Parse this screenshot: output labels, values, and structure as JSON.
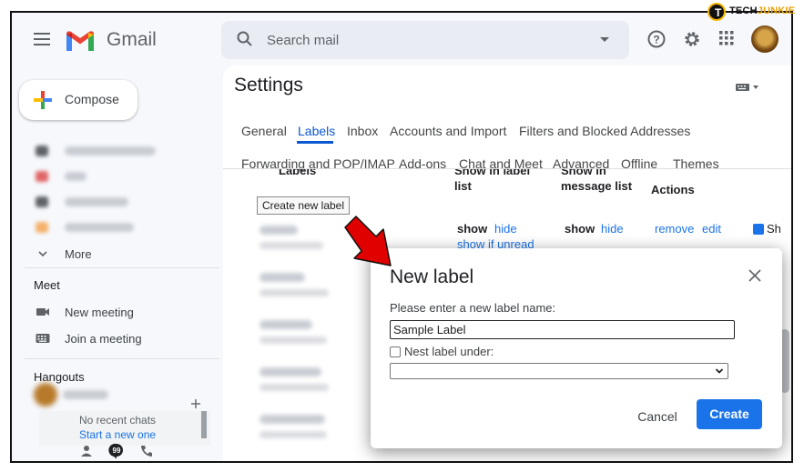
{
  "brand": {
    "app_name": "Gmail",
    "watermark_prefix": "TECH",
    "watermark_suffix": "JUNKIE"
  },
  "search": {
    "placeholder": "Search mail"
  },
  "sidebar": {
    "compose_label": "Compose",
    "more_label": "More",
    "meet_heading": "Meet",
    "meet_items": [
      {
        "label": "New meeting",
        "icon": "video-icon"
      },
      {
        "label": "Join a meeting",
        "icon": "keyboard-icon"
      }
    ],
    "hangouts_heading": "Hangouts",
    "no_chats": "No recent chats",
    "start_new": "Start a new one"
  },
  "settings": {
    "title": "Settings",
    "tabs_row1": [
      "General",
      "Labels",
      "Inbox",
      "Accounts and Import",
      "Filters and Blocked Addresses"
    ],
    "tabs_row2": [
      "Forwarding and POP/IMAP",
      "Add-ons",
      "Chat and Meet",
      "Advanced",
      "Offline",
      "Themes"
    ],
    "active_tab": "Labels",
    "columns": {
      "labels": "Labels",
      "show_in_label_list": "Show in label list",
      "show_in_message_list": "Show in message list",
      "actions": "Actions"
    },
    "create_new_label_button": "Create new label",
    "first_row": {
      "label_list_show": "show",
      "label_list_hide": "hide",
      "label_list_unread": "show if unread",
      "message_list_show": "show",
      "message_list_hide": "hide",
      "remove": "remove",
      "edit": "edit",
      "show_in_imap": "Sh"
    }
  },
  "dialog": {
    "title": "New label",
    "prompt": "Please enter a new label name:",
    "input_value": "Sample Label",
    "nest_label": "Nest label under:",
    "nest_checked": false,
    "nest_selected": "",
    "cancel_label": "Cancel",
    "create_label": "Create"
  },
  "colors": {
    "accent": "#1a73e8",
    "arrow": "#e00000"
  }
}
